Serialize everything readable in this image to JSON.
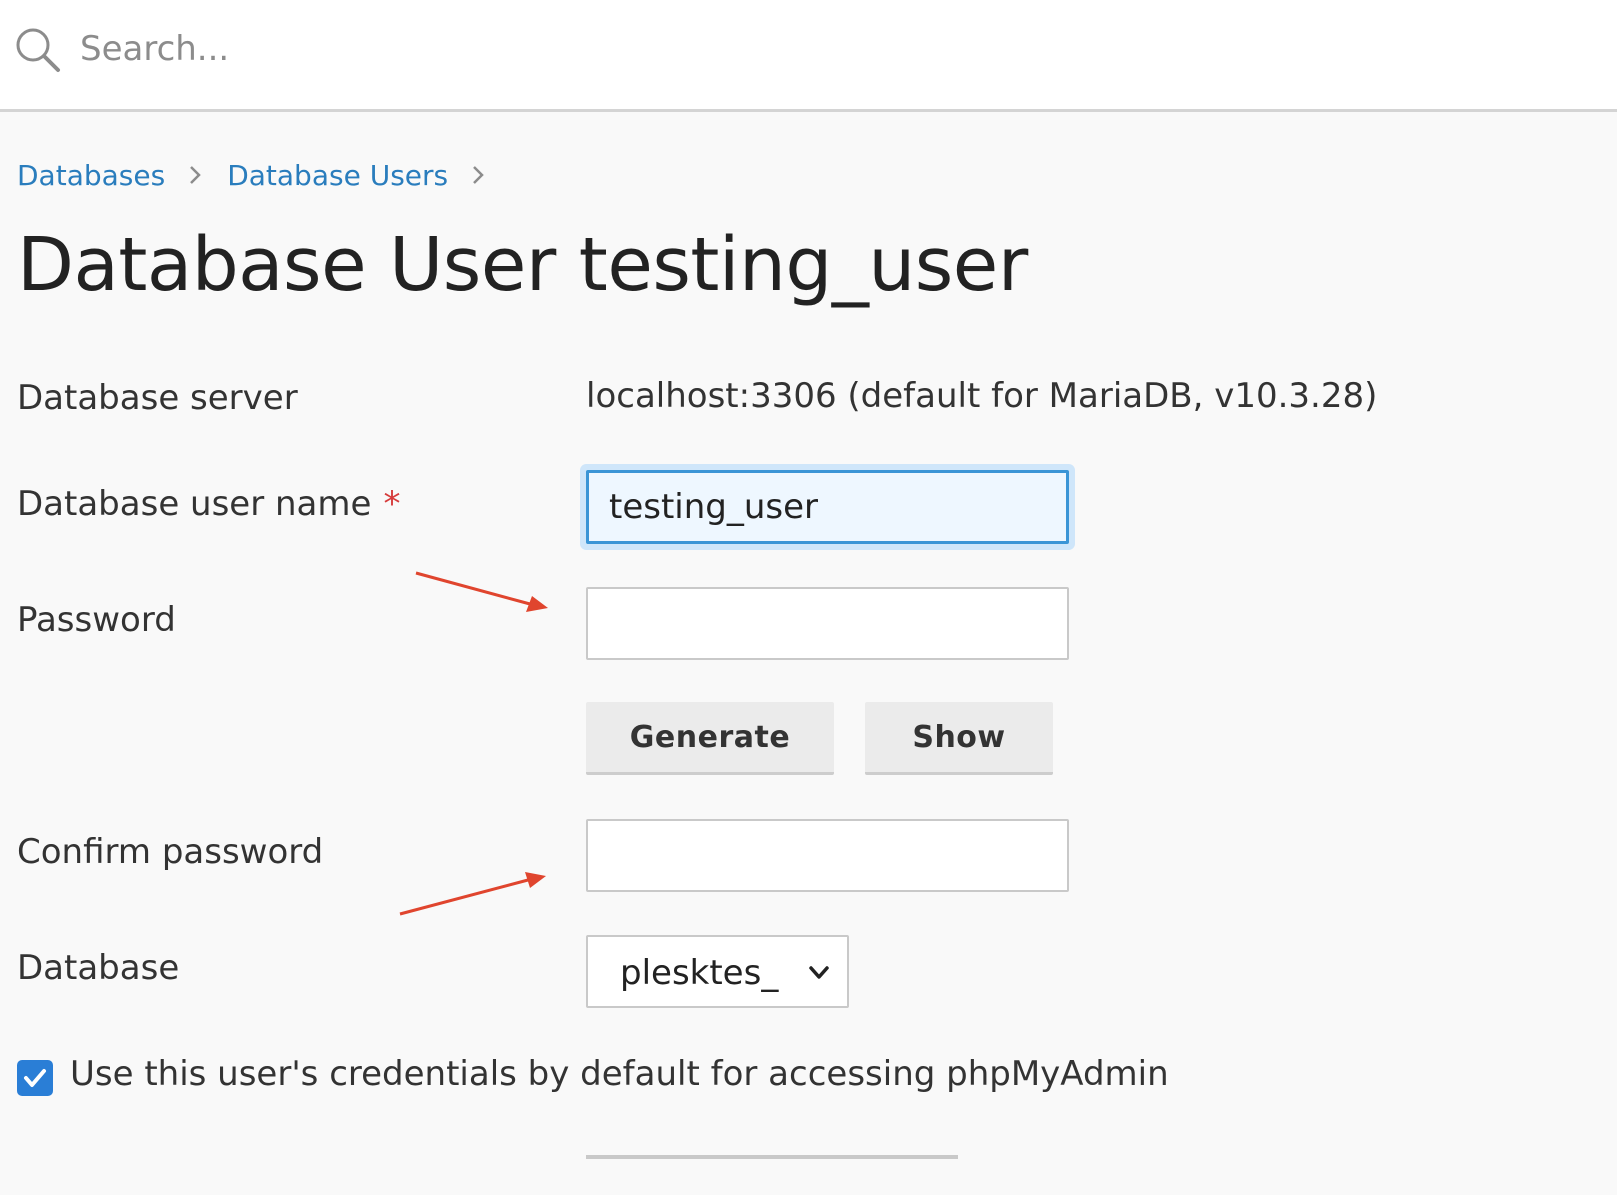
{
  "search": {
    "placeholder": "Search..."
  },
  "breadcrumb": [
    {
      "label": "Databases"
    },
    {
      "label": "Database Users"
    }
  ],
  "page": {
    "title": "Database User testing_user"
  },
  "form": {
    "server": {
      "label": "Database server",
      "value": "localhost:3306 (default for MariaDB, v10.3.28)"
    },
    "username": {
      "label": "Database user name",
      "required_mark": "*",
      "value": "testing_user"
    },
    "password": {
      "label": "Password",
      "value": ""
    },
    "generate_label": "Generate",
    "show_label": "Show",
    "confirm": {
      "label": "Confirm password",
      "value": ""
    },
    "database": {
      "label": "Database",
      "selected": "plesktes_"
    },
    "phpmyadmin_checkbox": {
      "label": "Use this user's credentials by default for accessing phpMyAdmin",
      "checked": true
    }
  },
  "colors": {
    "link": "#2a7dbd",
    "required": "#d63b3b",
    "focus_border": "#3b95d6",
    "checkbox": "#2a7ed6",
    "annotation_arrow": "#e0452e"
  }
}
